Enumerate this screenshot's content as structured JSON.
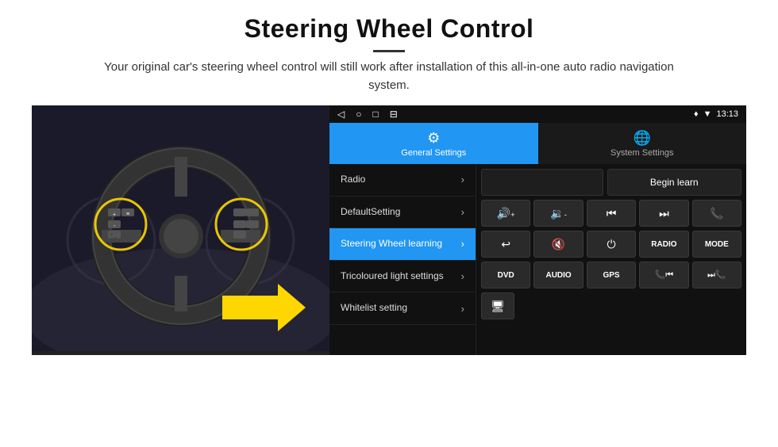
{
  "header": {
    "title": "Steering Wheel Control",
    "divider": true,
    "subtitle": "Your original car's steering wheel control will still work after installation of this all-in-one auto radio navigation system."
  },
  "status_bar": {
    "icons": [
      "◁",
      "○",
      "□",
      "⊟"
    ],
    "right_icons": "♦ ▼",
    "time": "13:13"
  },
  "tabs": [
    {
      "label": "General Settings",
      "icon": "⚙",
      "active": true
    },
    {
      "label": "System Settings",
      "icon": "🌐",
      "active": false
    }
  ],
  "menu_items": [
    {
      "label": "Radio",
      "active": false
    },
    {
      "label": "DefaultSetting",
      "active": false
    },
    {
      "label": "Steering Wheel learning",
      "active": true
    },
    {
      "label": "Tricoloured light settings",
      "active": false
    },
    {
      "label": "Whitelist setting",
      "active": false
    }
  ],
  "control_panel": {
    "begin_learn_label": "Begin learn",
    "button_rows": [
      [
        {
          "type": "icon",
          "symbol": "🔊+",
          "label": "vol-up"
        },
        {
          "type": "icon",
          "symbol": "🔉-",
          "label": "vol-down"
        },
        {
          "type": "icon",
          "symbol": "⏮",
          "label": "prev"
        },
        {
          "type": "icon",
          "symbol": "⏭",
          "label": "next"
        },
        {
          "type": "icon",
          "symbol": "📞",
          "label": "call"
        }
      ],
      [
        {
          "type": "icon",
          "symbol": "↩",
          "label": "back"
        },
        {
          "type": "icon",
          "symbol": "🔇",
          "label": "mute"
        },
        {
          "type": "icon",
          "symbol": "⏻",
          "label": "power"
        },
        {
          "type": "text",
          "text": "RADIO",
          "label": "radio-btn"
        },
        {
          "type": "text",
          "text": "MODE",
          "label": "mode-btn"
        }
      ],
      [
        {
          "type": "text",
          "text": "DVD",
          "label": "dvd-btn"
        },
        {
          "type": "text",
          "text": "AUDIO",
          "label": "audio-btn"
        },
        {
          "type": "text",
          "text": "GPS",
          "label": "gps-btn"
        },
        {
          "type": "icon",
          "symbol": "📞⏮",
          "label": "call-prev"
        },
        {
          "type": "icon",
          "symbol": "⏭📞",
          "label": "call-next"
        }
      ],
      [
        {
          "type": "icon",
          "symbol": "🖥",
          "label": "screen-btn"
        }
      ]
    ]
  }
}
